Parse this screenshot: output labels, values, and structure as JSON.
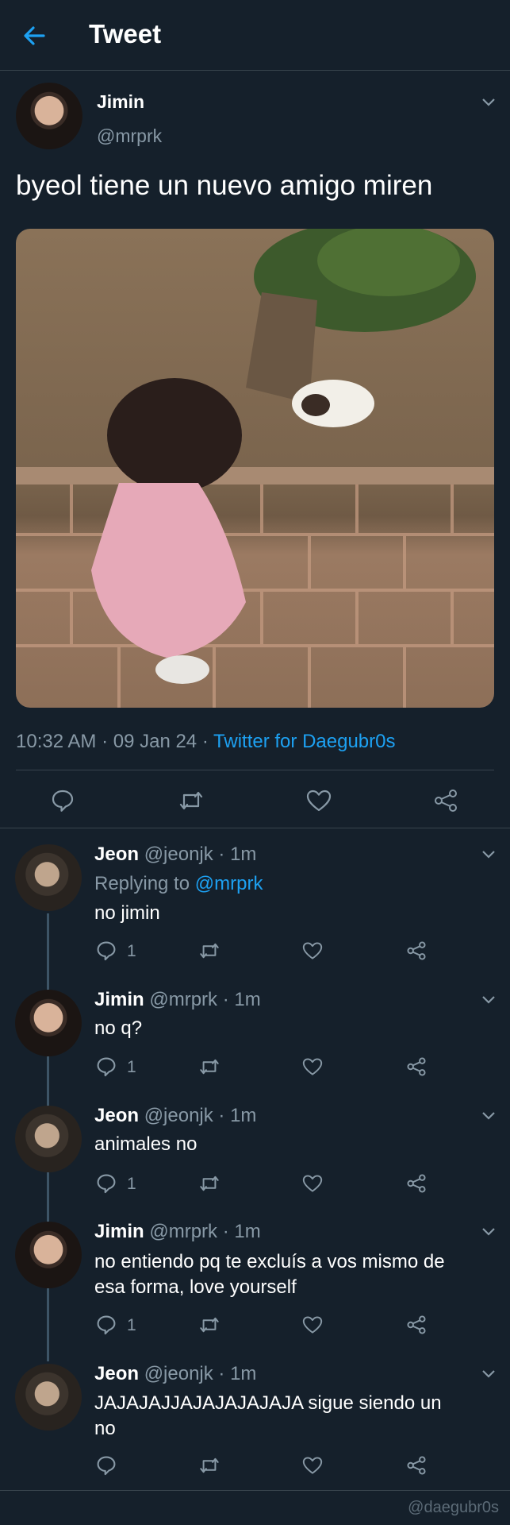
{
  "header": {
    "title": "Tweet"
  },
  "tweet": {
    "name": "Jimin",
    "handle": "@mrprk",
    "text": "byeol tiene un nuevo amigo miren",
    "time": "10:32 AM · 09 Jan 24 · ",
    "source": "Twitter for Daegubr0s"
  },
  "replies": [
    {
      "name": "Jeon",
      "meta": "@jeonjk · 1m",
      "replying_prefix": "Replying to ",
      "replying_to": "@mrprk",
      "text": "no jimin",
      "reply_count": "1"
    },
    {
      "name": "Jimin",
      "meta": "@mrprk · 1m",
      "text": "no q?",
      "reply_count": "1"
    },
    {
      "name": "Jeon",
      "meta": "@jeonjk · 1m",
      "text": "animales no",
      "reply_count": "1"
    },
    {
      "name": "Jimin",
      "meta": "@mrprk · 1m",
      "text_line1": "no entiendo pq te excluís a vos mismo de",
      "text_line2": "esa forma, love yourself",
      "reply_count": "1"
    },
    {
      "name": "Jeon",
      "meta": "@jeonjk · 1m",
      "text_line1": "JAJAJAJJAJAJAJAJAJA sigue siendo un",
      "text_line2": "no",
      "reply_count": ""
    }
  ],
  "watermark": "@daegubr0s",
  "colors": {
    "background": "#15202b",
    "accent": "#1da1f2",
    "muted": "#8899a6",
    "border": "#38444d"
  },
  "icons": [
    "back-arrow-icon",
    "chevron-down-icon",
    "reply-icon",
    "retweet-icon",
    "like-icon",
    "share-icon"
  ]
}
